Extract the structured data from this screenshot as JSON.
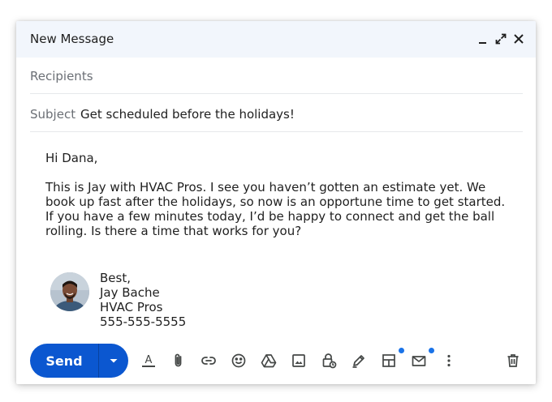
{
  "window": {
    "title": "New Message"
  },
  "recipients": {
    "placeholder": "Recipients",
    "value": ""
  },
  "subject": {
    "label": "Subject",
    "value": "Get scheduled before the holidays!"
  },
  "message": {
    "greeting": "Hi Dana,",
    "paragraph_lines": [
      "This is Jay with HVAC Pros. I see you haven’t gotten an estimate yet. We",
      "book up fast after the holidays, so now is an opportune time to get started.",
      "If you have a few minutes today, I’d be happy to connect and get the ball",
      "rolling. Is there a time that works for you?"
    ]
  },
  "signature": {
    "closing": "Best,",
    "name": "Jay Bache",
    "company": "HVAC Pros",
    "phone": "555-555-5555"
  },
  "toolbar": {
    "send_label": "Send",
    "icons": [
      "text-format-icon",
      "attach-icon",
      "link-icon",
      "emoji-icon",
      "drive-icon",
      "photo-icon",
      "confidential-lock-icon",
      "signature-pen-icon",
      "layout-icon",
      "mail-template-icon",
      "more-options-icon",
      "trash-icon"
    ],
    "accent_color": "#0b57d0",
    "notification_dot_color": "#1a73e8"
  }
}
